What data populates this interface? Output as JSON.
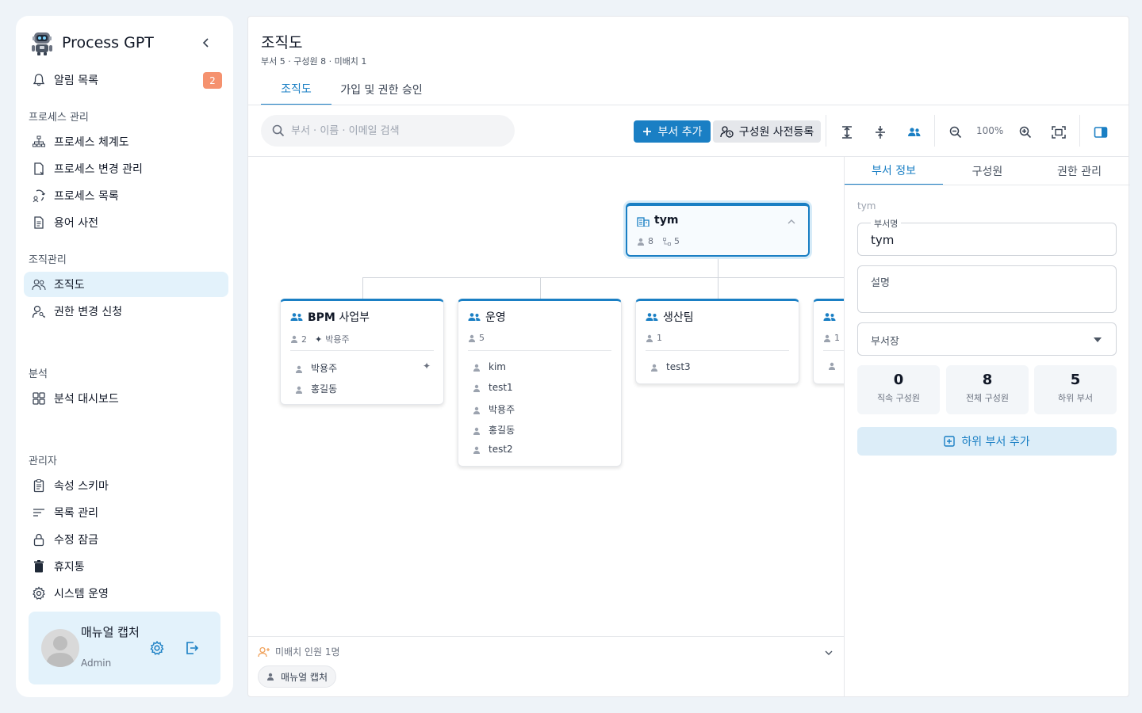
{
  "app": {
    "name": "Process GPT"
  },
  "sidebar": {
    "alerts": {
      "label": "알림 목록",
      "count": "2"
    },
    "sections": [
      {
        "title": "프로세스 관리",
        "items": [
          "프로세스 체계도",
          "프로세스 변경 관리",
          "프로세스 목록",
          "용어 사전"
        ]
      },
      {
        "title": "조직관리",
        "items": [
          "조직도",
          "권한 변경 신청"
        ]
      },
      {
        "title": "분석",
        "items": [
          "분석 대시보드"
        ]
      },
      {
        "title": "관리자",
        "items": [
          "속성 스키마",
          "목록 관리",
          "수정 잠금",
          "휴지통",
          "시스템 운영"
        ]
      }
    ],
    "user": {
      "name": "매뉴얼 캡처",
      "role": "Admin"
    }
  },
  "main": {
    "title": "조직도",
    "subtitle": "부서 5 · 구성원 8 · 미배치 1",
    "tabs": [
      "조직도",
      "가입 및 권한 승인"
    ],
    "toolbar": {
      "search_placeholder": "부서 · 이름 · 이메일 검색",
      "add_dept": "부서 추가",
      "pre_register": "구성원 사전등록",
      "zoom": "100%"
    },
    "root": {
      "name": "tym",
      "members": "8",
      "depts": "5"
    },
    "departments": [
      {
        "name": "BPM 사업부",
        "count": "2",
        "leader": "박용주",
        "members": [
          "박용주",
          "홍길동"
        ]
      },
      {
        "name": "운영",
        "count": "5",
        "members": [
          "kim",
          "test1",
          "박용주",
          "홍길동",
          "test2"
        ]
      },
      {
        "name": "생산팀",
        "count": "1",
        "members": [
          "test3"
        ]
      },
      {
        "name": "",
        "count": "1",
        "members": [
          ""
        ]
      }
    ],
    "unassigned": {
      "label": "미배치 인원 1명",
      "members": [
        "매뉴얼 캡처"
      ]
    }
  },
  "panel": {
    "tabs": [
      "부서 정보",
      "구성원",
      "권한 관리"
    ],
    "breadcrumb": "tym",
    "dept_name_label": "부서명",
    "dept_name_value": "tym",
    "desc_label": "설명",
    "head_label": "부서장",
    "stats": [
      {
        "value": "0",
        "label": "직속 구성원"
      },
      {
        "value": "8",
        "label": "전체 구성원"
      },
      {
        "value": "5",
        "label": "하위 부서"
      }
    ],
    "add_sub": "하위 부서 추가"
  },
  "colors": {
    "accent": "#1a7fc4",
    "badge": "#f5926f",
    "active_bg": "#e3f2fb"
  }
}
